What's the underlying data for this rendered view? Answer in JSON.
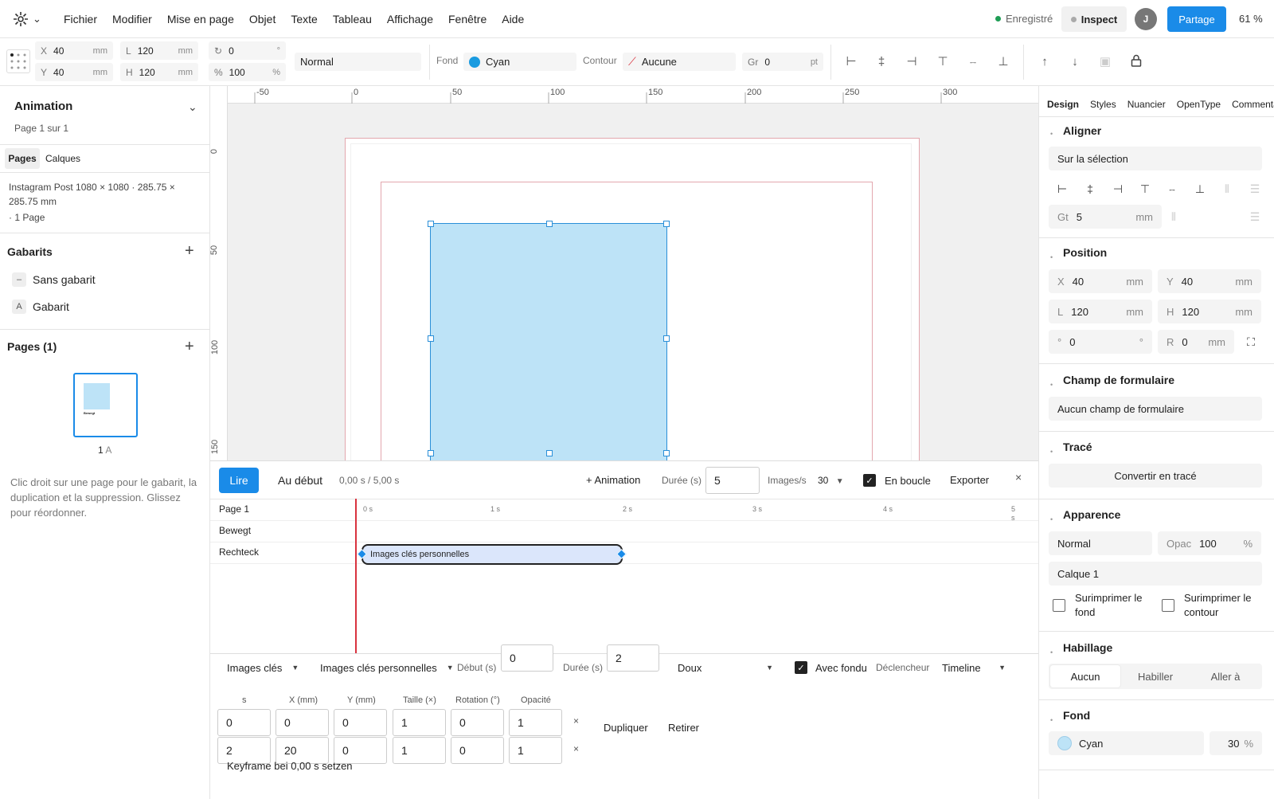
{
  "menubar": {
    "items": [
      "Fichier",
      "Modifier",
      "Mise en page",
      "Objet",
      "Texte",
      "Tableau",
      "Affichage",
      "Fenêtre",
      "Aide"
    ],
    "status": "Enregistré",
    "inspect": "Inspect",
    "avatar": "J",
    "share": "Partage",
    "zoom": "61 %"
  },
  "toolbar": {
    "x_label": "X",
    "x_value": "40",
    "y_label": "Y",
    "y_value": "40",
    "w_label": "L",
    "w_value": "120",
    "h_label": "H",
    "h_value": "120",
    "unit_mm": "mm",
    "rot_value": "0",
    "rot_unit": "°",
    "pct_label": "%",
    "pct_value": "100",
    "pct_unit": "%",
    "blend": "Normal",
    "fill_label": "Fond",
    "fill_value": "Cyan",
    "stroke_label": "Contour",
    "stroke_value": "Aucune",
    "weight_label": "Gr",
    "weight_value": "0",
    "weight_unit": "pt"
  },
  "left": {
    "doc_title": "Animation",
    "page_info": "Page 1 sur 1",
    "tab_pages": "Pages",
    "tab_layers": "Calques",
    "format": "Instagram Post 1080 × 1080 · 285.75 × 285.75 mm",
    "page_count": "· 1 Page",
    "masters_title": "Gabarits",
    "masters": [
      {
        "badge": "–",
        "label": "Sans gabarit"
      },
      {
        "badge": "A",
        "label": "Gabarit"
      }
    ],
    "pages_title": "Pages (1)",
    "thumb_text": "Bewegt",
    "page_num": "1",
    "page_master": "A",
    "hint": "Clic droit sur une page pour le gabarit, la duplication et la suppression. Glissez pour réordonner."
  },
  "rulers": {
    "h": [
      "-50",
      "0",
      "50",
      "100",
      "150",
      "200",
      "250",
      "300"
    ],
    "v": [
      "0",
      "50",
      "100",
      "150"
    ]
  },
  "timeline": {
    "play": "Lire",
    "to_start": "Au début",
    "time": "0,00 s / 5,00 s",
    "add_anim": "+ Animation",
    "duration_label": "Durée (s)",
    "duration_value": "5",
    "fps_label": "Images/s",
    "fps_value": "30",
    "loop_label": "En boucle",
    "export": "Exporter",
    "close": "×",
    "rows": [
      "Page 1",
      "Bewegt",
      "Rechteck"
    ],
    "ticks": [
      "0 s",
      "1 s",
      "2 s",
      "3 s",
      "4 s",
      "5 s"
    ],
    "clip_label": "Images clés personnelles"
  },
  "keyframes": {
    "type_select": "Images clés",
    "preset_select": "Images clés personnelles",
    "start_label": "Début (s)",
    "start_value": "0",
    "dur_label": "Durée (s)",
    "dur_value": "2",
    "easing": "Doux",
    "fade_label": "Avec fondu",
    "trigger_label": "Déclencheur",
    "trigger_value": "Timeline",
    "headers": [
      "s",
      "X (mm)",
      "Y (mm)",
      "Taille (×)",
      "Rotation (°)",
      "Opacité"
    ],
    "rows": [
      [
        "0",
        "0",
        "0",
        "1",
        "0",
        "1"
      ],
      [
        "2",
        "20",
        "0",
        "1",
        "0",
        "1"
      ]
    ],
    "remove_x": "×",
    "duplicate": "Dupliquer",
    "remove": "Retirer",
    "set_kf": "Keyframe bei 0,00 s setzen"
  },
  "right": {
    "tabs": [
      "Design",
      "Styles",
      "Nuancier",
      "OpenType",
      "Commentaires"
    ],
    "align_title": "Aligner",
    "align_target": "Sur la sélection",
    "gap_label": "Gt",
    "gap_value": "5",
    "gap_unit": "mm",
    "position_title": "Position",
    "pos": {
      "x": "40",
      "y": "40",
      "w": "120",
      "h": "120",
      "rot": "0",
      "radius": "0"
    },
    "lbl": {
      "x": "X",
      "y": "Y",
      "w": "L",
      "h": "H",
      "rot": "°",
      "r": "R",
      "mm": "mm",
      "deg": "°"
    },
    "form_title": "Champ de formulaire",
    "form_value": "Aucun champ de formulaire",
    "path_title": "Tracé",
    "path_btn": "Convertir en tracé",
    "appearance_title": "Apparence",
    "blend": "Normal",
    "opacity_label": "Opac",
    "opacity_value": "100",
    "opacity_unit": "%",
    "layer": "Calque 1",
    "overprint_fill": "Surimprimer le fond",
    "overprint_stroke": "Surimprimer le contour",
    "wrap_title": "Habillage",
    "wrap_opts": [
      "Aucun",
      "Habiller",
      "Aller à"
    ],
    "fill_title": "Fond",
    "fill_color": "Cyan",
    "fill_pct": "30",
    "fill_unit": "%"
  },
  "colors": {
    "accent": "#1a8be8",
    "shape_fill": "#bde3f7",
    "cyan": "#1a9be0",
    "playhead": "#d9333f",
    "saved": "#1f9d55"
  }
}
